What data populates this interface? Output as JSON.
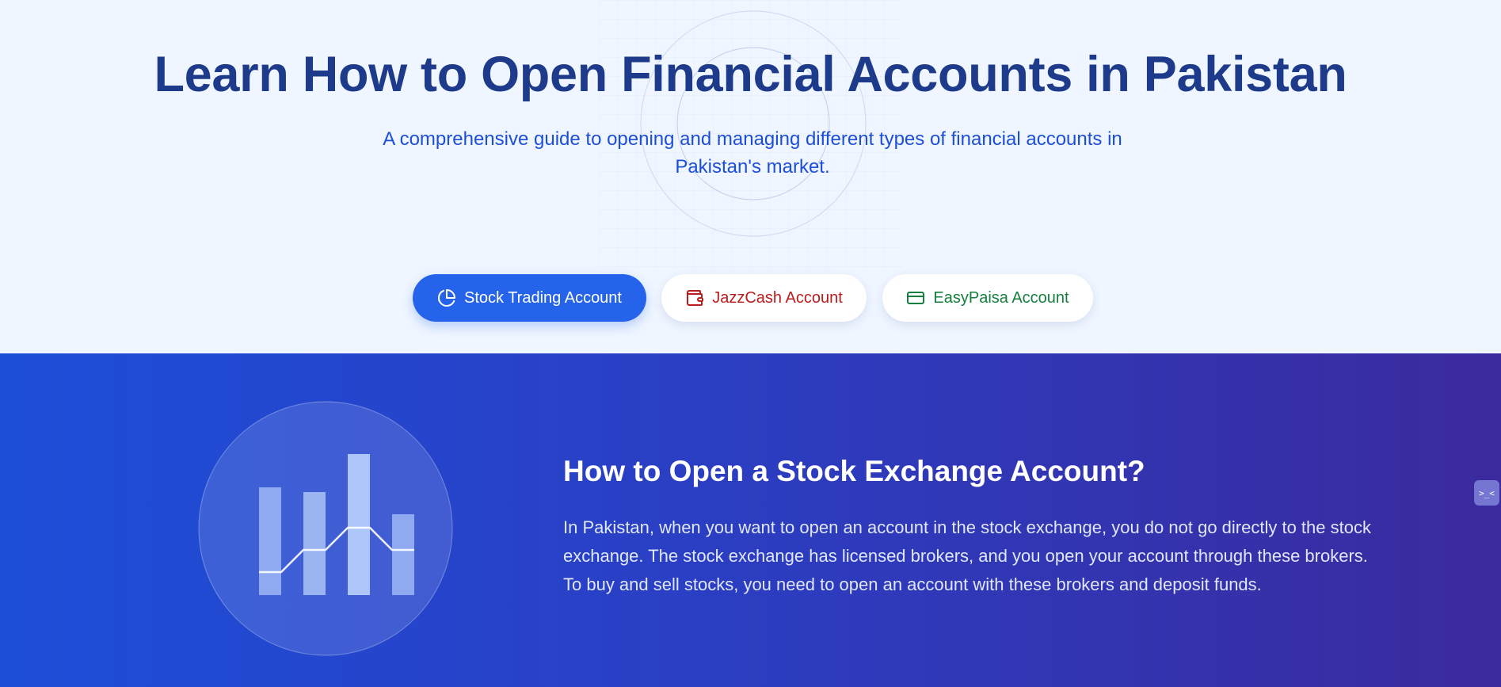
{
  "hero": {
    "title": "Learn How to Open Financial Accounts in Pakistan",
    "subtitle": "A comprehensive guide to opening and managing different types of financial accounts in Pakistan's market."
  },
  "tabs": [
    {
      "label": "Stock Trading Account",
      "icon": "pie-chart-icon",
      "active": true,
      "color": "#2563eb"
    },
    {
      "label": "JazzCash Account",
      "icon": "wallet-icon",
      "active": false,
      "color": "#b91c1c"
    },
    {
      "label": "EasyPaisa Account",
      "icon": "credit-card-icon",
      "active": false,
      "color": "#15803d"
    }
  ],
  "section": {
    "title": "How to Open a Stock Exchange Account?",
    "body": "In Pakistan, when you want to open an account in the stock exchange, you do not go directly to the stock exchange. The stock exchange has licensed brokers, and you open your account through these brokers. To buy and sell stocks, you need to open an account with these brokers and deposit funds.",
    "illustration_icon": "stock-chart-icon"
  },
  "floating_button": {
    "label": ">_<",
    "icon": "terminal-icon"
  },
  "colors": {
    "hero_background": "#eff6ff",
    "title": "#1e3a8a",
    "subtitle": "#1d4ed8",
    "accent": "#2563eb",
    "section_gradient_start": "#1d4ed8",
    "section_gradient_end": "#3b2a9e"
  }
}
